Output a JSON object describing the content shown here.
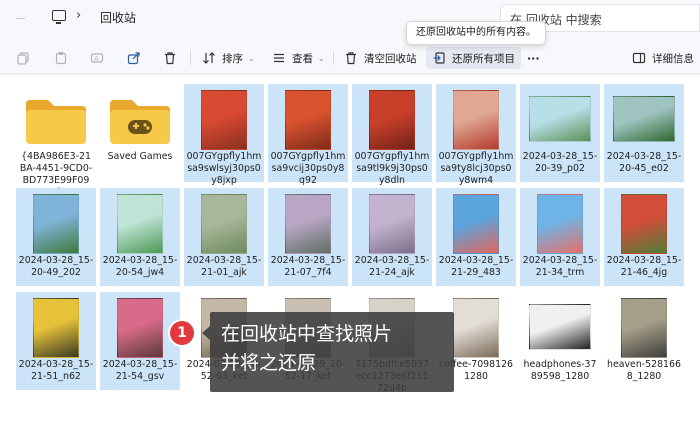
{
  "address_bar": {
    "path": "回收站",
    "search_placeholder": "在 回收站 中搜索",
    "tooltip": "还原回收站中的所有内容。"
  },
  "toolbar": {
    "sort_label": "排序",
    "view_label": "查看",
    "empty_recycle_bin_label": "清空回收站",
    "restore_all_label": "还原所有项目",
    "more_label": "···",
    "details_label": "详细信息"
  },
  "items": [
    {
      "name": "{4BA986E3-21BA-4451-9CD0-BD773E99F09D}",
      "kind": "folder",
      "selected": false
    },
    {
      "name": "Saved Games",
      "kind": "folder-game",
      "selected": false
    },
    {
      "name": "007GYgpfly1hmsa9swlsyj30ps0y8jxp",
      "kind": "photo",
      "selected": true,
      "colors": [
        "#d94a32",
        "#8a3020"
      ]
    },
    {
      "name": "007GYgpfly1hmsa9vcij30ps0y8q92",
      "kind": "photo",
      "selected": true,
      "colors": [
        "#d9532f",
        "#7e2b1c"
      ]
    },
    {
      "name": "007GYgpfly1hmsa9tl9k9j30ps0y8dln",
      "kind": "photo",
      "selected": true,
      "colors": [
        "#c9402a",
        "#732219"
      ]
    },
    {
      "name": "007GYgpfly1hmsa9ty8lcj30ps0y8wm4",
      "kind": "photo",
      "selected": true,
      "colors": [
        "#e0a894",
        "#b33a2c"
      ]
    },
    {
      "name": "2024-03-28_15-20-39_p02",
      "kind": "photo",
      "selected": true,
      "colors": [
        "#b7dfe7",
        "#5c8f55"
      ]
    },
    {
      "name": "2024-03-28_15-20-45_e02",
      "kind": "photo",
      "selected": true,
      "colors": [
        "#9fc3c0",
        "#2f6a2e"
      ]
    },
    {
      "name": "2024-03-28_15-20-49_202",
      "kind": "photo",
      "selected": true,
      "colors": [
        "#7fb3d8",
        "#3d7a3a"
      ]
    },
    {
      "name": "2024-03-28_15-20-54_jw4",
      "kind": "photo",
      "selected": true,
      "colors": [
        "#bfe3d6",
        "#4a9a55"
      ]
    },
    {
      "name": "2024-03-28_15-21-01_ajk",
      "kind": "photo",
      "selected": true,
      "colors": [
        "#a8b79a",
        "#6d8a5e"
      ]
    },
    {
      "name": "2024-03-28_15-21-07_7f4",
      "kind": "photo",
      "selected": true,
      "colors": [
        "#b8a6c4",
        "#5e6f63"
      ]
    },
    {
      "name": "2024-03-28_15-21-24_ajk",
      "kind": "photo",
      "selected": true,
      "colors": [
        "#c3b3cf",
        "#7d6f8a"
      ]
    },
    {
      "name": "2024-03-28_15-21-29_483",
      "kind": "photo",
      "selected": true,
      "colors": [
        "#5aa5de",
        "#e2665a"
      ]
    },
    {
      "name": "2024-03-28_15-21-34_trm",
      "kind": "photo",
      "selected": true,
      "colors": [
        "#6fb4e6",
        "#e6706a"
      ]
    },
    {
      "name": "2024-03-28_15-21-46_4jg",
      "kind": "photo",
      "selected": true,
      "colors": [
        "#d24d3a",
        "#4f7d35"
      ]
    },
    {
      "name": "2024-03-28_15-21-51_n62",
      "kind": "photo",
      "selected": true,
      "colors": [
        "#e6c23a",
        "#3a3a22"
      ]
    },
    {
      "name": "2024-03-28_15-21-54_gsv",
      "kind": "photo",
      "selected": true,
      "colors": [
        "#d96b8a",
        "#5c3a3a"
      ]
    },
    {
      "name": "2024-03-29_10-52-03_ket",
      "kind": "photo",
      "selected": false,
      "colors": [
        "#c4b7a6",
        "#6b5d4d"
      ]
    },
    {
      "name": "2024-03-29_10-52-17_ket",
      "kind": "photo",
      "selected": false,
      "colors": [
        "#c9c0b3",
        "#7a6d5e"
      ]
    },
    {
      "name": "7175bdfce5037ecc1273e6f21172d4b",
      "kind": "photo",
      "selected": false,
      "colors": [
        "#d7d2c8",
        "#8c8478"
      ]
    },
    {
      "name": "coffee-70981261280",
      "kind": "photo",
      "selected": false,
      "colors": [
        "#e2ddd5",
        "#7b6a5a"
      ]
    },
    {
      "name": "headphones-3789598_1280",
      "kind": "photo",
      "selected": false,
      "colors": [
        "#f0f0f0",
        "#222222"
      ]
    },
    {
      "name": "heaven-5281668_1280",
      "kind": "photo",
      "selected": false,
      "colors": [
        "#a69f8a",
        "#3f3f3a"
      ]
    }
  ],
  "callout": {
    "number": "1",
    "text_line1": "在回收站中查找照片",
    "text_line2": "并将之还原"
  }
}
